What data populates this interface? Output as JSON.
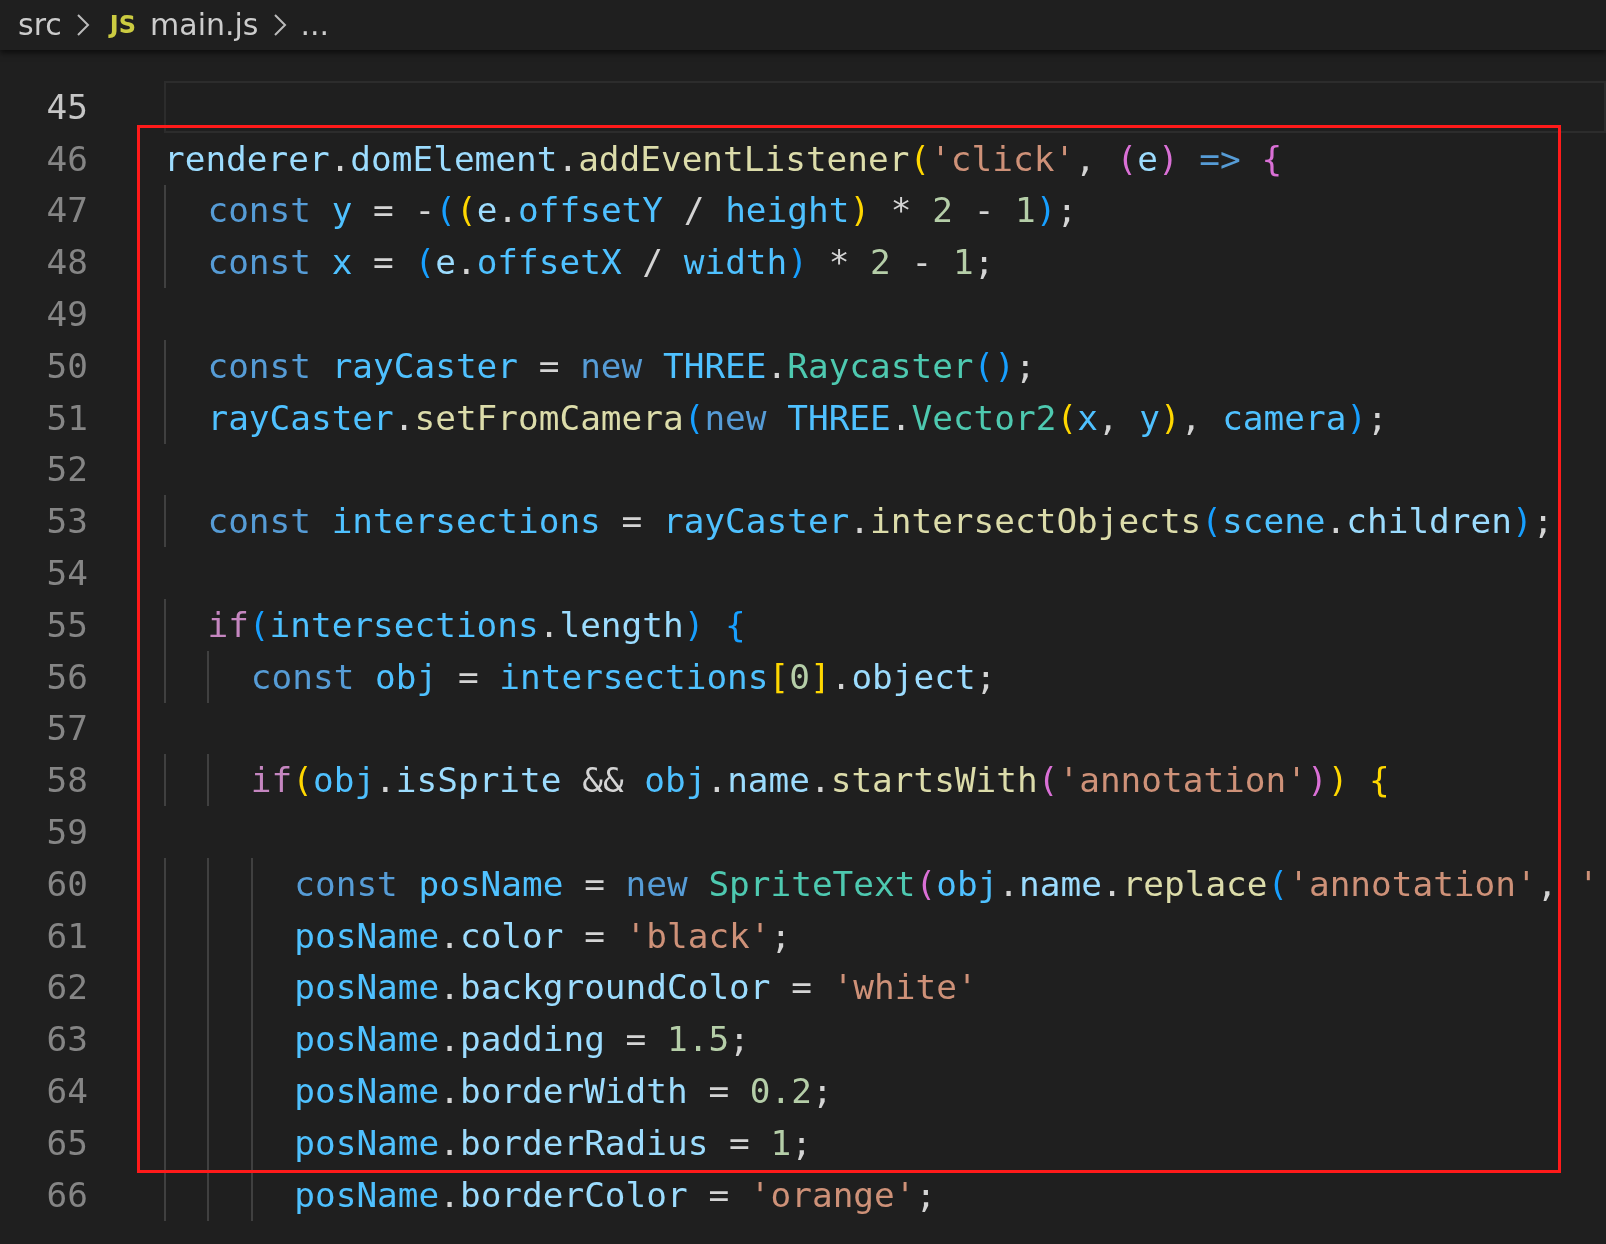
{
  "breadcrumbs": [
    {
      "label": "src"
    },
    {
      "label": "main.js",
      "icon": "JS"
    },
    {
      "label": "..."
    }
  ],
  "lines": [
    {
      "number": "45",
      "current": true,
      "highlighted": false
    },
    {
      "number": "46",
      "current": false,
      "highlighted": true,
      "segments": [
        {
          "text": "renderer",
          "kind": "var"
        },
        {
          "text": ".",
          "kind": "op"
        },
        {
          "text": "domElement",
          "kind": "var"
        },
        {
          "text": ".",
          "kind": "op"
        },
        {
          "text": "addEventListener",
          "kind": "fn"
        },
        {
          "text": "(",
          "kind": "b1"
        },
        {
          "text": "'click'",
          "kind": "str"
        },
        {
          "text": ", ",
          "kind": "op"
        },
        {
          "text": "(",
          "kind": "b2"
        },
        {
          "text": "e",
          "kind": "var"
        },
        {
          "text": ") ",
          "kind": "b2"
        },
        {
          "text": "=> ",
          "kind": "kw"
        },
        {
          "text": "{",
          "kind": "b2"
        }
      ]
    },
    {
      "number": "47",
      "current": false,
      "highlighted": true,
      "segments": [
        {
          "text": "  const ",
          "kind": "kw"
        },
        {
          "text": "y",
          "kind": "cvar"
        },
        {
          "text": " = -",
          "kind": "op"
        },
        {
          "text": "(",
          "kind": "b3"
        },
        {
          "text": "(",
          "kind": "b1"
        },
        {
          "text": "e",
          "kind": "var"
        },
        {
          "text": ".",
          "kind": "op"
        },
        {
          "text": "offsetY",
          "kind": "cvar"
        },
        {
          "text": " / ",
          "kind": "op"
        },
        {
          "text": "height",
          "kind": "cvar"
        },
        {
          "text": ")",
          "kind": "b1"
        },
        {
          "text": " * ",
          "kind": "op"
        },
        {
          "text": "2",
          "kind": "num"
        },
        {
          "text": " - ",
          "kind": "op"
        },
        {
          "text": "1",
          "kind": "num"
        },
        {
          "text": ")",
          "kind": "b3"
        },
        {
          "text": ";",
          "kind": "op"
        }
      ]
    },
    {
      "number": "48",
      "current": false,
      "highlighted": true,
      "segments": [
        {
          "text": "  const ",
          "kind": "kw"
        },
        {
          "text": "x",
          "kind": "cvar"
        },
        {
          "text": " = ",
          "kind": "op"
        },
        {
          "text": "(",
          "kind": "b3"
        },
        {
          "text": "e",
          "kind": "var"
        },
        {
          "text": ".",
          "kind": "op"
        },
        {
          "text": "offsetX",
          "kind": "cvar"
        },
        {
          "text": " / ",
          "kind": "op"
        },
        {
          "text": "width",
          "kind": "cvar"
        },
        {
          "text": ")",
          "kind": "b3"
        },
        {
          "text": " * ",
          "kind": "op"
        },
        {
          "text": "2",
          "kind": "num"
        },
        {
          "text": " - ",
          "kind": "op"
        },
        {
          "text": "1",
          "kind": "num"
        },
        {
          "text": ";",
          "kind": "op"
        }
      ]
    },
    {
      "number": "49",
      "current": false,
      "highlighted": true
    },
    {
      "number": "50",
      "current": false,
      "highlighted": true,
      "segments": [
        {
          "text": "  const ",
          "kind": "kw"
        },
        {
          "text": "rayCaster",
          "kind": "cvar"
        },
        {
          "text": " = ",
          "kind": "op"
        },
        {
          "text": "new ",
          "kind": "kw"
        },
        {
          "text": "THREE",
          "kind": "cvar"
        },
        {
          "text": ".",
          "kind": "op"
        },
        {
          "text": "Raycaster",
          "kind": "cls"
        },
        {
          "text": "()",
          "kind": "b3"
        },
        {
          "text": ";",
          "kind": "op"
        }
      ]
    },
    {
      "number": "51",
      "current": false,
      "highlighted": true,
      "segments": [
        {
          "text": "  rayCaster",
          "kind": "cvar"
        },
        {
          "text": ".",
          "kind": "op"
        },
        {
          "text": "setFromCamera",
          "kind": "fn"
        },
        {
          "text": "(",
          "kind": "b3"
        },
        {
          "text": "new ",
          "kind": "kw"
        },
        {
          "text": "THREE",
          "kind": "cvar"
        },
        {
          "text": ".",
          "kind": "op"
        },
        {
          "text": "Vector2",
          "kind": "cls"
        },
        {
          "text": "(",
          "kind": "b1"
        },
        {
          "text": "x",
          "kind": "cvar"
        },
        {
          "text": ", ",
          "kind": "op"
        },
        {
          "text": "y",
          "kind": "cvar"
        },
        {
          "text": ")",
          "kind": "b1"
        },
        {
          "text": ", ",
          "kind": "op"
        },
        {
          "text": "camera",
          "kind": "cvar"
        },
        {
          "text": ")",
          "kind": "b3"
        },
        {
          "text": ";",
          "kind": "op"
        }
      ]
    },
    {
      "number": "52",
      "current": false,
      "highlighted": true
    },
    {
      "number": "53",
      "current": false,
      "highlighted": true,
      "segments": [
        {
          "text": "  const ",
          "kind": "kw"
        },
        {
          "text": "intersections",
          "kind": "cvar"
        },
        {
          "text": " = ",
          "kind": "op"
        },
        {
          "text": "rayCaster",
          "kind": "cvar"
        },
        {
          "text": ".",
          "kind": "op"
        },
        {
          "text": "intersectObjects",
          "kind": "fn"
        },
        {
          "text": "(",
          "kind": "b3"
        },
        {
          "text": "scene",
          "kind": "cvar"
        },
        {
          "text": ".",
          "kind": "op"
        },
        {
          "text": "children",
          "kind": "var"
        },
        {
          "text": ")",
          "kind": "b3"
        },
        {
          "text": ";",
          "kind": "op"
        }
      ]
    },
    {
      "number": "54",
      "current": false,
      "highlighted": true
    },
    {
      "number": "55",
      "current": false,
      "highlighted": true,
      "segments": [
        {
          "text": "  if",
          "kind": "ctl"
        },
        {
          "text": "(",
          "kind": "b3"
        },
        {
          "text": "intersections",
          "kind": "cvar"
        },
        {
          "text": ".",
          "kind": "op"
        },
        {
          "text": "length",
          "kind": "var"
        },
        {
          "text": ") {",
          "kind": "b3"
        }
      ]
    },
    {
      "number": "56",
      "current": false,
      "highlighted": true,
      "segments": [
        {
          "text": "    const ",
          "kind": "kw"
        },
        {
          "text": "obj",
          "kind": "cvar"
        },
        {
          "text": " = ",
          "kind": "op"
        },
        {
          "text": "intersections",
          "kind": "cvar"
        },
        {
          "text": "[",
          "kind": "b1"
        },
        {
          "text": "0",
          "kind": "num"
        },
        {
          "text": "]",
          "kind": "b1"
        },
        {
          "text": ".",
          "kind": "op"
        },
        {
          "text": "object",
          "kind": "var"
        },
        {
          "text": ";",
          "kind": "op"
        }
      ]
    },
    {
      "number": "57",
      "current": false,
      "highlighted": true
    },
    {
      "number": "58",
      "current": false,
      "highlighted": true,
      "segments": [
        {
          "text": "    if",
          "kind": "ctl"
        },
        {
          "text": "(",
          "kind": "b1"
        },
        {
          "text": "obj",
          "kind": "cvar"
        },
        {
          "text": ".",
          "kind": "op"
        },
        {
          "text": "isSprite",
          "kind": "var"
        },
        {
          "text": " && ",
          "kind": "op"
        },
        {
          "text": "obj",
          "kind": "cvar"
        },
        {
          "text": ".",
          "kind": "op"
        },
        {
          "text": "name",
          "kind": "var"
        },
        {
          "text": ".",
          "kind": "op"
        },
        {
          "text": "startsWith",
          "kind": "fn"
        },
        {
          "text": "(",
          "kind": "b2"
        },
        {
          "text": "'annotation'",
          "kind": "str"
        },
        {
          "text": ")",
          "kind": "b2"
        },
        {
          "text": ") {",
          "kind": "b1"
        }
      ]
    },
    {
      "number": "59",
      "current": false,
      "highlighted": true
    },
    {
      "number": "60",
      "current": false,
      "highlighted": true,
      "segments": [
        {
          "text": "      const ",
          "kind": "kw"
        },
        {
          "text": "posName",
          "kind": "cvar"
        },
        {
          "text": " = ",
          "kind": "op"
        },
        {
          "text": "new ",
          "kind": "kw"
        },
        {
          "text": "SpriteText",
          "kind": "cls"
        },
        {
          "text": "(",
          "kind": "b2"
        },
        {
          "text": "obj",
          "kind": "cvar"
        },
        {
          "text": ".",
          "kind": "op"
        },
        {
          "text": "name",
          "kind": "var"
        },
        {
          "text": ".",
          "kind": "op"
        },
        {
          "text": "replace",
          "kind": "fn"
        },
        {
          "text": "(",
          "kind": "b3"
        },
        {
          "text": "'annotation'",
          "kind": "str"
        },
        {
          "text": ", ",
          "kind": "op"
        },
        {
          "text": "'",
          "kind": "str"
        }
      ]
    },
    {
      "number": "61",
      "current": false,
      "highlighted": true,
      "segments": [
        {
          "text": "      posName",
          "kind": "cvar"
        },
        {
          "text": ".",
          "kind": "op"
        },
        {
          "text": "color",
          "kind": "var"
        },
        {
          "text": " = ",
          "kind": "op"
        },
        {
          "text": "'black'",
          "kind": "str"
        },
        {
          "text": ";",
          "kind": "op"
        }
      ]
    },
    {
      "number": "62",
      "current": false,
      "highlighted": true,
      "segments": [
        {
          "text": "      posName",
          "kind": "cvar"
        },
        {
          "text": ".",
          "kind": "op"
        },
        {
          "text": "backgroundColor",
          "kind": "var"
        },
        {
          "text": " = ",
          "kind": "op"
        },
        {
          "text": "'white'",
          "kind": "str"
        }
      ]
    },
    {
      "number": "63",
      "current": false,
      "highlighted": true,
      "segments": [
        {
          "text": "      posName",
          "kind": "cvar"
        },
        {
          "text": ".",
          "kind": "op"
        },
        {
          "text": "padding",
          "kind": "var"
        },
        {
          "text": " = ",
          "kind": "op"
        },
        {
          "text": "1.5",
          "kind": "num"
        },
        {
          "text": ";",
          "kind": "op"
        }
      ]
    },
    {
      "number": "64",
      "current": false,
      "highlighted": true,
      "segments": [
        {
          "text": "      posName",
          "kind": "cvar"
        },
        {
          "text": ".",
          "kind": "op"
        },
        {
          "text": "borderWidth",
          "kind": "var"
        },
        {
          "text": " = ",
          "kind": "op"
        },
        {
          "text": "0.2",
          "kind": "num"
        },
        {
          "text": ";",
          "kind": "op"
        }
      ]
    },
    {
      "number": "65",
      "current": false,
      "highlighted": true,
      "segments": [
        {
          "text": "      posName",
          "kind": "cvar"
        },
        {
          "text": ".",
          "kind": "op"
        },
        {
          "text": "borderRadius",
          "kind": "var"
        },
        {
          "text": " = ",
          "kind": "op"
        },
        {
          "text": "1",
          "kind": "num"
        },
        {
          "text": ";",
          "kind": "op"
        }
      ]
    },
    {
      "number": "66",
      "current": false,
      "highlighted": false,
      "segments": [
        {
          "text": "      posName",
          "kind": "cvar"
        },
        {
          "text": ".",
          "kind": "op"
        },
        {
          "text": "borderColor",
          "kind": "var"
        },
        {
          "text": " = ",
          "kind": "op"
        },
        {
          "text": "'orange'",
          "kind": "str"
        },
        {
          "text": ";",
          "kind": "op"
        }
      ]
    }
  ]
}
